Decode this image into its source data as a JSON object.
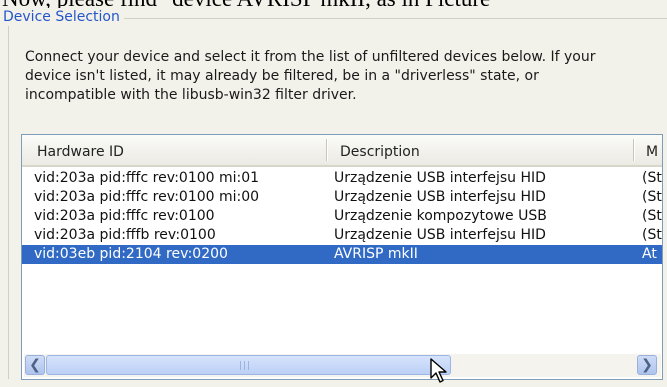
{
  "document_text": "Now, please find \"device AVRISP mkII, as in Picture",
  "group": {
    "title": "Device Selection"
  },
  "description": "Connect your device and select it from the list of unfiltered devices below. If your\ndevice isn't listed, it may already be filtered, be in a \"driverless\" state, or\nincompatible with the libusb-win32 filter driver.",
  "table": {
    "columns": [
      "Hardware ID",
      "Description",
      "M"
    ],
    "rows": [
      {
        "hardware_id": "vid:203a pid:fffc rev:0100 mi:01",
        "description": "Urządzenie USB interfejsu HID",
        "m": "(St"
      },
      {
        "hardware_id": "vid:203a pid:fffc rev:0100 mi:00",
        "description": "Urządzenie USB interfejsu HID",
        "m": "(St"
      },
      {
        "hardware_id": "vid:203a pid:fffc rev:0100",
        "description": "Urządzenie kompozytowe USB",
        "m": "(St"
      },
      {
        "hardware_id": "vid:203a pid:fffb rev:0100",
        "description": "Urządzenie USB interfejsu HID",
        "m": "(St"
      },
      {
        "hardware_id": "vid:03eb pid:2104 rev:0200",
        "description": "AVRISP mkII",
        "m": "At",
        "selected": true
      }
    ]
  },
  "scrollbar": {
    "left_icon": "arrow-left-icon",
    "right_icon": "arrow-right-icon",
    "grip": "|||",
    "position_fraction": 0.0
  },
  "colors": {
    "selection": "#316ac5",
    "group_title": "#2556c9"
  }
}
